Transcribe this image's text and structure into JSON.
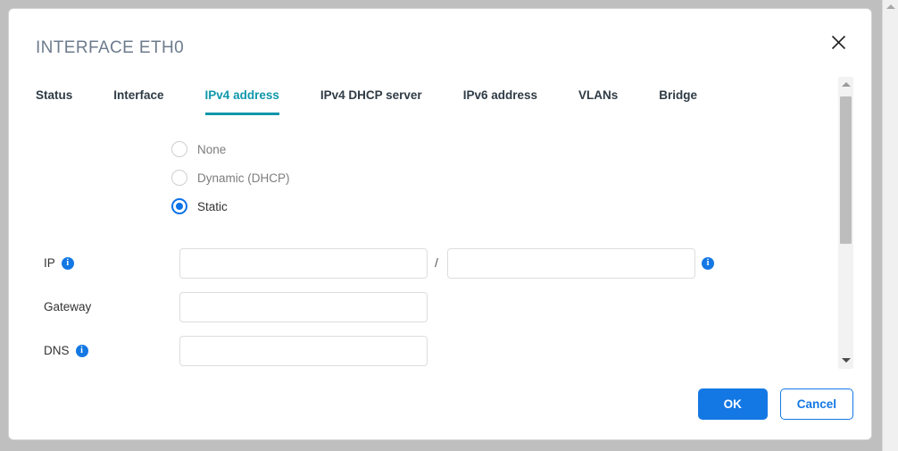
{
  "dialog": {
    "title": "INTERFACE ETH0",
    "close_icon": "close-icon"
  },
  "tabs": [
    {
      "label": "Status",
      "active": false
    },
    {
      "label": "Interface",
      "active": false
    },
    {
      "label": "IPv4 address",
      "active": true
    },
    {
      "label": "IPv4 DHCP server",
      "active": false
    },
    {
      "label": "IPv6 address",
      "active": false
    },
    {
      "label": "VLANs",
      "active": false
    },
    {
      "label": "Bridge",
      "active": false
    }
  ],
  "address_mode": {
    "selected": "Static",
    "options": [
      {
        "label": "None",
        "selected": false
      },
      {
        "label": "Dynamic (DHCP)",
        "selected": false
      },
      {
        "label": "Static",
        "selected": true
      }
    ]
  },
  "fields": {
    "ip": {
      "label": "IP",
      "info_icon": "info-icon",
      "value": "",
      "placeholder": "",
      "separator": "/",
      "mask_value": "",
      "mask_placeholder": "",
      "mask_info_icon": "info-icon"
    },
    "gateway": {
      "label": "Gateway",
      "value": "",
      "placeholder": ""
    },
    "dns": {
      "label": "DNS",
      "info_icon": "info-icon",
      "value": "",
      "placeholder": ""
    }
  },
  "footer": {
    "ok_label": "OK",
    "cancel_label": "Cancel"
  },
  "info_glyph": "i",
  "colors": {
    "accent_tab": "#0f97ab",
    "primary_button": "#1478e4",
    "info_icon": "#1478e4",
    "radio_selected": "#0b72e7",
    "title_text": "#6d7b8d"
  }
}
